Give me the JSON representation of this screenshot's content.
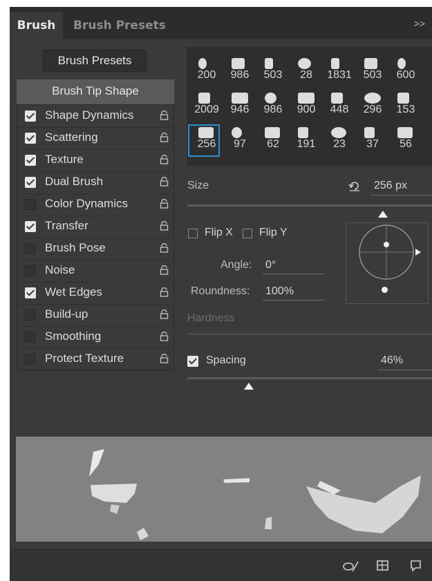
{
  "tabs": {
    "active": "Brush",
    "inactive": "Brush Presets",
    "menu_icon": ">>"
  },
  "left": {
    "presets_button": "Brush Presets",
    "tip_shape": "Brush Tip Shape",
    "options": [
      {
        "label": "Shape Dynamics",
        "checked": true
      },
      {
        "label": "Scattering",
        "checked": true
      },
      {
        "label": "Texture",
        "checked": true
      },
      {
        "label": "Dual Brush",
        "checked": true
      },
      {
        "label": "Color Dynamics",
        "checked": false
      },
      {
        "label": "Transfer",
        "checked": true
      },
      {
        "label": "Brush Pose",
        "checked": false
      },
      {
        "label": "Noise",
        "checked": false
      },
      {
        "label": "Wet Edges",
        "checked": true
      },
      {
        "label": "Build-up",
        "checked": false
      },
      {
        "label": "Smoothing",
        "checked": false
      },
      {
        "label": "Protect Texture",
        "checked": false
      }
    ]
  },
  "brush_grid": {
    "rows": [
      [
        "200",
        "986",
        "503",
        "28",
        "1831",
        "503",
        "600"
      ],
      [
        "2009",
        "946",
        "986",
        "900",
        "448",
        "296",
        "153"
      ],
      [
        "256",
        "97",
        "62",
        "191",
        "23",
        "37",
        "56"
      ]
    ],
    "selected": "256"
  },
  "size": {
    "label": "Size",
    "value": "256 px",
    "slider_fraction": 0.8
  },
  "flip": {
    "x_label": "Flip X",
    "y_label": "Flip Y"
  },
  "angle": {
    "label": "Angle:",
    "value": "0°"
  },
  "roundness": {
    "label": "Roundness:",
    "value": "100%"
  },
  "hardness": {
    "label": "Hardness"
  },
  "spacing": {
    "label": "Spacing",
    "value": "46%",
    "checked": true,
    "slider_fraction": 0.25
  },
  "colors": {
    "panel": "#3a3a3a",
    "accent": "#2a8fd6"
  }
}
